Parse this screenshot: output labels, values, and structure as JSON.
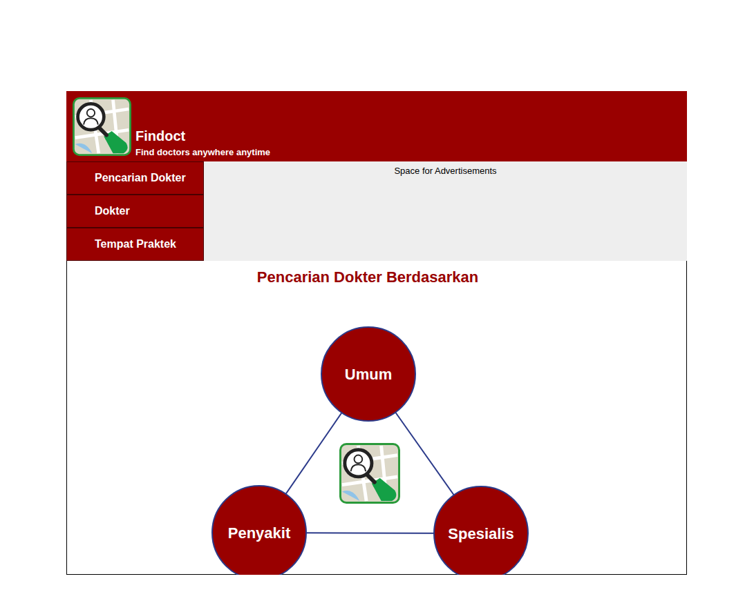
{
  "header": {
    "title": "Findoct",
    "tagline": "Find doctors anywhere anytime"
  },
  "nav": {
    "items": [
      {
        "label": "Pencarian Dokter"
      },
      {
        "label": "Dokter"
      },
      {
        "label": "Tempat Praktek"
      }
    ]
  },
  "ad": {
    "text": "Space for Advertisements"
  },
  "search": {
    "heading": "Pencarian Dokter Berdasarkan",
    "categories": [
      {
        "label": "Umum"
      },
      {
        "label": "Penyakit"
      },
      {
        "label": "Spesialis"
      }
    ]
  }
}
